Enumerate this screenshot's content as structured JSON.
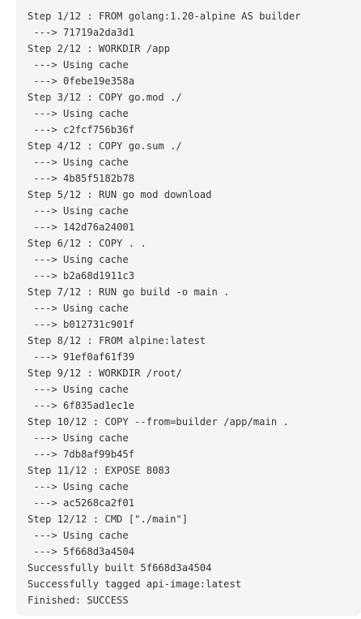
{
  "console": {
    "lines": [
      "Step 1/12 : FROM golang:1.20-alpine AS builder",
      " ---> 71719a2da3d1",
      "Step 2/12 : WORKDIR /app",
      " ---> Using cache",
      " ---> 0febe19e358a",
      "Step 3/12 : COPY go.mod ./",
      " ---> Using cache",
      " ---> c2fcf756b36f",
      "Step 4/12 : COPY go.sum ./",
      " ---> Using cache",
      " ---> 4b85f5182b78",
      "Step 5/12 : RUN go mod download",
      " ---> Using cache",
      " ---> 142d76a24001",
      "Step 6/12 : COPY . .",
      " ---> Using cache",
      " ---> b2a68d1911c3",
      "Step 7/12 : RUN go build -o main .",
      " ---> Using cache",
      " ---> b012731c901f",
      "Step 8/12 : FROM alpine:latest",
      " ---> 91ef0af61f39",
      "Step 9/12 : WORKDIR /root/",
      " ---> Using cache",
      " ---> 6f835ad1ec1e",
      "Step 10/12 : COPY --from=builder /app/main .",
      " ---> Using cache",
      " ---> 7db8af99b45f",
      "Step 11/12 : EXPOSE 8083",
      " ---> Using cache",
      " ---> ac5268ca2f01",
      "Step 12/12 : CMD [\"./main\"]",
      " ---> Using cache",
      " ---> 5f668d3a4504",
      "Successfully built 5f668d3a4504",
      "Successfully tagged api-image:latest",
      "Finished: SUCCESS"
    ]
  }
}
